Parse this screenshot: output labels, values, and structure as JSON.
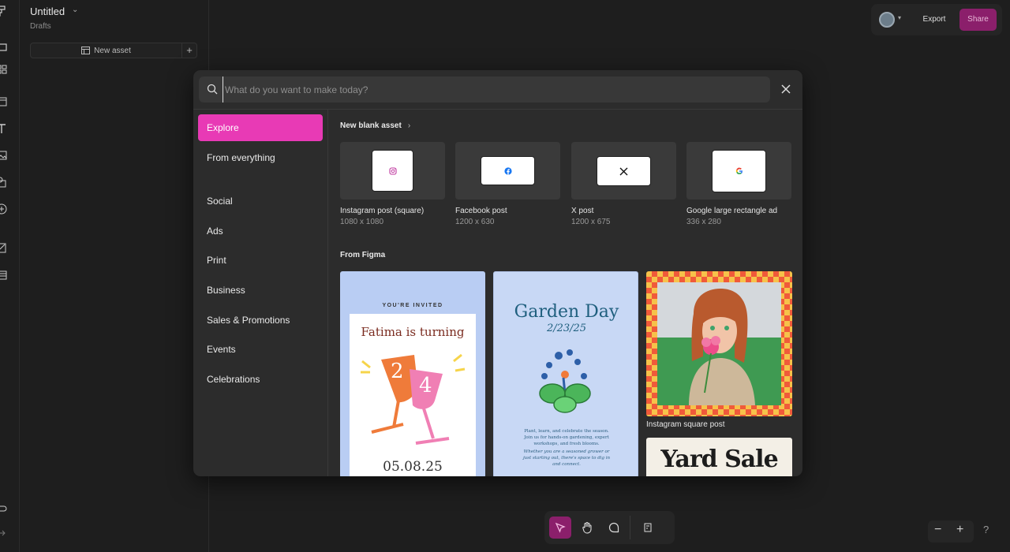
{
  "file": {
    "title": "Untitled",
    "location": "Drafts",
    "new_asset_label": "New asset"
  },
  "header": {
    "export_label": "Export",
    "share_label": "Share"
  },
  "modal": {
    "search_placeholder": "What do you want to make today?",
    "sidebar": [
      "Explore",
      "From everything",
      "Social",
      "Ads",
      "Print",
      "Business",
      "Sales & Promotions",
      "Events",
      "Celebrations"
    ],
    "new_blank_title": "New blank asset",
    "blank_assets": [
      {
        "name": "Instagram post (square)",
        "size": "1080 x 1080",
        "icon": "instagram-icon"
      },
      {
        "name": "Facebook post",
        "size": "1200 x 630",
        "icon": "facebook-icon"
      },
      {
        "name": "X post",
        "size": "1200 x 675",
        "icon": "x-icon"
      },
      {
        "name": "Google large rectangle ad",
        "size": "336 x 280",
        "icon": "google-icon"
      }
    ],
    "from_figma_title": "From Figma",
    "templates": {
      "invite": {
        "kicker": "YOU'RE INVITED",
        "headline": "Fatima is turning",
        "num1": "2",
        "num2": "4",
        "date": "05.08.25"
      },
      "garden": {
        "title": "Garden Day",
        "date": "2/23/25",
        "body": "Plant, learn, and celebrate the season. Join us for hands-on gardening, expert workshops, and fresh blooms.",
        "body_italic": "Whether you are a seasoned grower or just starting out, there's space to dig in and connect."
      },
      "photo_label": "Instagram square post",
      "yard": "Yard Sale"
    }
  },
  "colors": {
    "accent": "#e83ab5",
    "share_bg": "#8b1f6b",
    "invite_bg": "#b9cdf3",
    "garden_bg": "#c8d8f5"
  }
}
